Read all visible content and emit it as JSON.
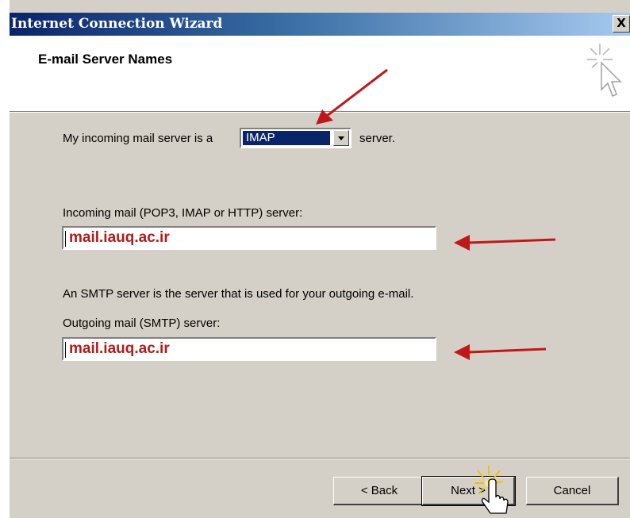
{
  "window": {
    "title": "Internet Connection Wizard",
    "close_label": "X"
  },
  "header": {
    "title": "E-mail Server Names",
    "icon": "wizard-cursor-icon"
  },
  "form": {
    "incoming_prefix": "My incoming mail server is a",
    "server_type": "IMAP",
    "incoming_suffix": "server.",
    "incoming_label": "Incoming mail (POP3, IMAP or HTTP) server:",
    "incoming_value": "mail.iauq.ac.ir",
    "smtp_info": "An SMTP server is the server that is used for your outgoing e-mail.",
    "outgoing_label": "Outgoing mail (SMTP) server:",
    "outgoing_value": "mail.iauq.ac.ir"
  },
  "buttons": {
    "back": "< Back",
    "next": "Next >",
    "cancel": "Cancel"
  },
  "colors": {
    "annotation_arrow": "#c01818",
    "title_gradient_start": "#0a246a",
    "dialog_bg": "#d4d0c8",
    "value_text": "#b01c1c"
  }
}
